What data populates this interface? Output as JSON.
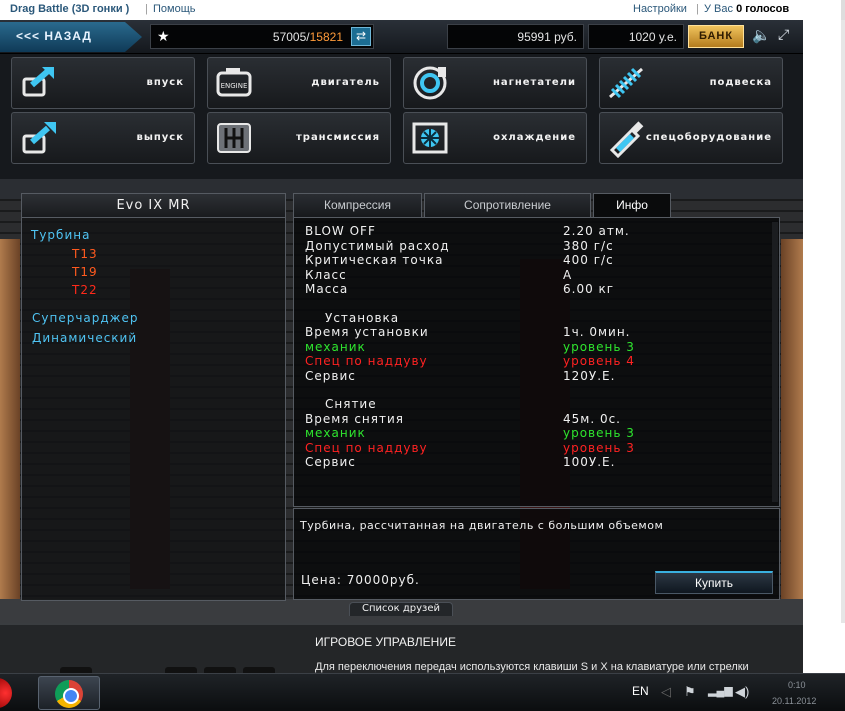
{
  "vk": {
    "app_title": "Drag Battle (3D гонки )",
    "help": "Помощь",
    "settings": "Настройки",
    "votes_prefix": "У Вас ",
    "votes_value": "0 голосов"
  },
  "topbar": {
    "back_label": "<<< НАЗАД",
    "xp_current": "57005",
    "xp_sep": "/",
    "xp_max": "15821",
    "money_rub": "95991 руб.",
    "money_ue": "1020 у.е.",
    "bank_label": "БАНК"
  },
  "categories": [
    {
      "label": "впуск",
      "icon": "intake-icon"
    },
    {
      "label": "двигатель",
      "icon": "engine-icon"
    },
    {
      "label": "нагнетатели",
      "icon": "turbo-icon"
    },
    {
      "label": "подвеска",
      "icon": "suspension-icon"
    },
    {
      "label": "выпуск",
      "icon": "exhaust-icon"
    },
    {
      "label": "трансмиссия",
      "icon": "transmission-icon"
    },
    {
      "label": "охлаждение",
      "icon": "cooling-icon"
    },
    {
      "label": "спецоборудование",
      "icon": "special-equipment-icon"
    }
  ],
  "list": {
    "car_name": "Evo IX MR",
    "turbo_label": "Турбина",
    "turbo_items": [
      "T13",
      "T19",
      "T22"
    ],
    "supercharger_label": "Суперчарджер",
    "dynamic_label": "Динамический"
  },
  "tabs": [
    "Компрессия",
    "Сопротивление",
    "Инфо"
  ],
  "info": {
    "blow_off_k": "BLOW OFF",
    "blow_off_v": "2.20 атм.",
    "flow_k": "Допустимый расход",
    "flow_v": "380 г/с",
    "critical_k": "Критическая точка",
    "critical_v": "400 г/с",
    "class_k": "Класс",
    "class_v": "A",
    "mass_k": "Масса",
    "mass_v": "6.00 кг",
    "install_heading": "Установка",
    "install_time_k": "Время установки",
    "install_time_v": "1ч. 0мин.",
    "install_mech_k": "механик",
    "install_mech_v": "уровень 3",
    "install_spec_k": "Спец по наддуву",
    "install_spec_v": "уровень 4",
    "install_service_k": "Сервис",
    "install_service_v": "120У.Е.",
    "removal_heading": "Снятие",
    "removal_time_k": "Время снятия",
    "removal_time_v": "45м. 0с.",
    "removal_mech_k": "механик",
    "removal_mech_v": "уровень 3",
    "removal_spec_k": "Спец по наддуву",
    "removal_spec_v": "уровень 3",
    "removal_service_k": "Сервис",
    "removal_service_v": "100У.Е."
  },
  "description": "Турбина, рассчитанная на двигатель с большим объемом",
  "price": "Цена: 70000руб.",
  "buy_label": "Купить",
  "friends_tab": "Список друзей",
  "below": {
    "title": "ИГРОВОЕ УПРАВЛЕНИЕ",
    "text": "Для переключения передач используются клавиши S и X на клавиатуре или стрелки"
  },
  "taskbar": {
    "lang": "EN",
    "time": "0:10",
    "date": "20.11.2012"
  },
  "colors": {
    "accent_blue": "#4fc3f2",
    "turbo_item": "#ff5a1f",
    "green": "#2ee52e",
    "red": "#ff2222",
    "bank_gold": "#e0ac40"
  }
}
